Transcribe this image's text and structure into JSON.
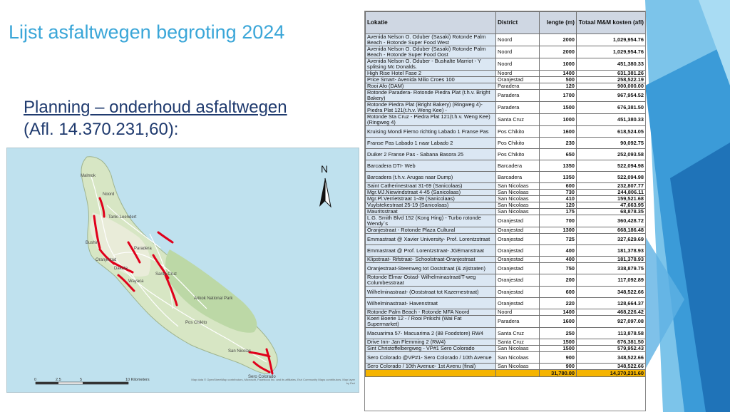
{
  "slide": {
    "title": "Lijst asfaltwegen begroting 2024",
    "subtitle_line1": "Planning – onderhoud asfaltwegen",
    "subtitle_line2": "(Afl. 14.370.231,60):"
  },
  "colors": {
    "title": "#3aa6d8",
    "subtitle": "#1f3a6e",
    "table_header_bg": "#cfd7e3",
    "table_first_col_bg": "#dbe7f3",
    "total_row_bg": "#f5b400",
    "route_red": "#e0001b",
    "land_green": "#d7e6c4",
    "sea_blue": "#bfe1ee",
    "slide_blue": "#2e86c9"
  },
  "map": {
    "north_label": "N",
    "scale_ticks": [
      "0",
      "2.5",
      "5",
      "10 Kilometers"
    ],
    "places": [
      "Malmok",
      "Noord",
      "Tanki Leendert",
      "Bushiri",
      "Oranjestad",
      "Dakota",
      "Paradera",
      "Wayaca",
      "Santa Cruz",
      "Arikok National Park",
      "Pos Chikito",
      "San Nicolas",
      "Sero Colorado"
    ],
    "attribution": "Map data © OpenStreetMap contributors, Microsoft, Facebook Inc. and its affiliates, Esri Community Maps contributors. Map layer by Esri"
  },
  "table": {
    "headers": [
      "Lokatie",
      "District",
      "lengte (m)",
      "Totaal M&M kosten (afl)"
    ],
    "rows": [
      [
        "Avenida Nelson O. Oduber (Sasaki) Rotonde Palm Beach - Rotonde Super Food West",
        "Noord",
        "2000",
        "1,029,954.76"
      ],
      [
        "Avenida Nelson O. Oduber (Sasaki) Rotonde Palm Beach - Rotonde Super Food Oost",
        "Noord",
        "2000",
        "1,029,954.76"
      ],
      [
        "Avenida Nelson O. Oduber - Bushalte Marriot - Y splitsing Mc Donalds.",
        "Noord",
        "1000",
        "451,380.33"
      ],
      [
        "High Rise Hotel Fase 2",
        "Noord",
        "1400",
        "631,381.26"
      ],
      [
        "Price Smart- Avenida Milio Croes 100",
        "Oranjestad",
        "500",
        "258,522.19"
      ],
      [
        "Rooi Afo (DAM)",
        "Paradera",
        "120",
        "900,000.00"
      ],
      [
        "Rotonde Paradera- Rotonde Piedra Plat (t.h.v. Bright Bakery)",
        "Paradera",
        "1700",
        "967,954.52"
      ],
      [
        "Rotonde Piedra Plat (Bright Bakery) (Ringweg 4)- Piedra Plat 121(t.h.v. Weng Kee) -",
        "Paradera",
        "1500",
        "676,381.50"
      ],
      [
        "Rotonde Sta Cruz - Piedra Plat 121(t.h.v. Weng Kee) (Ringweg 4)",
        "Santa Cruz",
        "1000",
        "451,380.33"
      ],
      [
        "Kruising Mondi Fierno richting Labado 1 Franse Pas",
        "Pos Chikito",
        "1600",
        "618,524.05"
      ],
      [
        "Franse Pas Labado 1 naar Labado 2",
        "Pos Chikito",
        "230",
        "90,092.75"
      ],
      [
        "Duiker 2 Franse Pas - Sabana Basora 25",
        "Pos Chikito",
        "650",
        "252,093.58"
      ],
      [
        "Barcadera DTI- Web",
        "Barcadera",
        "1350",
        "522,094.98"
      ],
      [
        "Barcadera (t.h.v. Arugas naar Dump)",
        "Barcadera",
        "1350",
        "522,094.98"
      ],
      [
        "Saint Catherinestraat 31-69 (Sanicolaas)",
        "San Nicolaas",
        "600",
        "232,807.77"
      ],
      [
        "Mgr.MJ.Niewindstraat 4-45 (Sanicolaas)",
        "San Nicolaas",
        "730",
        "244,806.11"
      ],
      [
        "Mgr.Pl.Verrietstraat 1-49 (Sanicolaas)",
        "San Nicolaas",
        "410",
        "159,521.68"
      ],
      [
        "Vuylstekestraat 25-19 (Sanicolaas)",
        "San Nicolaas",
        "120",
        "47,663.95"
      ],
      [
        "Mauritsstraat",
        "San Nicolaas",
        "175",
        "68,878.35"
      ],
      [
        "L.G. Smith Blvd 152 (Kong Hing) - Turbo rotonde Wendy`s",
        "Oranjestad",
        "700",
        "360,428.72"
      ],
      [
        "Oranjestraat - Rotonde Plaza Cultural",
        "Oranjestad",
        "1300",
        "668,186.48"
      ],
      [
        "Emmastraat @ Xavier University- Prof. Lorentzstraat",
        "Oranjestad",
        "725",
        "327,629.69"
      ],
      [
        "Emmastraat @ Prof. Lorentzstraat- JGEmanstraat",
        "Oranjestad",
        "400",
        "181,378.93"
      ],
      [
        "Klipstraat- Rifstraat- Schoolstraat-Oranjestraat",
        "Oranjestad",
        "400",
        "181,378.93"
      ],
      [
        "Oranjestraat-Steenweg tot Ooststraat (& zijstraten)",
        "Oranjestad",
        "750",
        "338,879.75"
      ],
      [
        "Rotonde Elmar Ostad- Wilhelminastraat/T-weg Columbesstraat",
        "Oranjestad",
        "200",
        "117,092.89"
      ],
      [
        "Wilhelminastraat- (Ooststraat tot Kazernestraat)",
        "Oranjestad",
        "600",
        "348,522.66"
      ],
      [
        "Wilhelminastraat- Havenstraat",
        "Oranjestad",
        "220",
        "128,664.37"
      ],
      [
        "Rotonde Palm Beach - Rotonde MFA Noord",
        "Noord",
        "1400",
        "468,226.42"
      ],
      [
        "Koeri Boerie 12 - / Rooi Prikichi (Wai Fat Supermarket)",
        "Paradera",
        "1600",
        "927,097.08"
      ],
      [
        "Macuarima 57- Macuarima 2 (88 Foodstore) RW4",
        "Santa Cruz",
        "250",
        "113,878.58"
      ],
      [
        "Drive Inn- Jan Flemming 2 (RW4)",
        "Santa Cruz",
        "1500",
        "676,381.50"
      ],
      [
        "Sint Christoffelbergweg - VP#1 Sero Colorado",
        "San Nicolaas",
        "1500",
        "579,952.43"
      ],
      [
        "Sero Colorado @VP#1- Sero Colorado / 10th Avenue",
        "San Nicolaas",
        "900",
        "348,522.66"
      ],
      [
        "Sero Colorado / 10th Avenue- 1st Avenu (final)",
        "San Nicolaas",
        "900",
        "348,522.66"
      ]
    ],
    "total_length": "31,780.00",
    "total_cost": "14,370,231.60"
  }
}
